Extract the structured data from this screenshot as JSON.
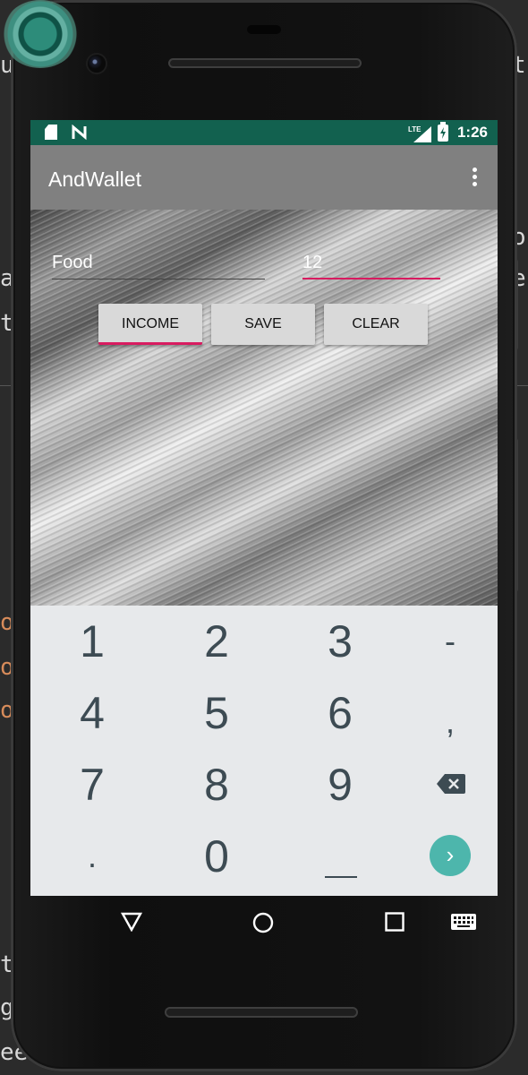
{
  "background": {
    "fragments": [
      "u",
      "a",
      "t",
      "o",
      "o",
      "o",
      "t",
      "g",
      "eel",
      "t",
      "o",
      "e"
    ]
  },
  "status_bar": {
    "time": "1:26",
    "network": "LTE",
    "icons": [
      "sd-card-icon",
      "n-icon",
      "lte-signal-icon",
      "battery-charging-icon"
    ]
  },
  "app_bar": {
    "title": "AndWallet",
    "menu_icon": "overflow-menu-icon"
  },
  "form": {
    "label_value": "Food",
    "amount_value": "12"
  },
  "buttons": {
    "income": "INCOME",
    "save": "SAVE",
    "clear": "CLEAR"
  },
  "keyboard": {
    "rows": [
      [
        "1",
        "2",
        "3",
        "-"
      ],
      [
        "4",
        "5",
        "6",
        ","
      ],
      [
        "7",
        "8",
        "9",
        "backspace"
      ],
      [
        ".",
        "0",
        "space",
        "go"
      ]
    ],
    "k1": "1",
    "k2": "2",
    "k3": "3",
    "kminus": "-",
    "k4": "4",
    "k5": "5",
    "k6": "6",
    "kcomma": ",",
    "k7": "7",
    "k8": "8",
    "k9": "9",
    "kdot": ".",
    "k0": "0",
    "go_glyph": "›"
  },
  "nav_bar": {
    "buttons": [
      "back-icon",
      "home-icon",
      "recents-icon",
      "keyboard-icon"
    ]
  },
  "colors": {
    "status_bar": "#12614f",
    "app_bar": "#808080",
    "accent": "#d81b60",
    "keyboard_go": "#4db6ac",
    "keyboard_bg": "#e7e9eb"
  }
}
